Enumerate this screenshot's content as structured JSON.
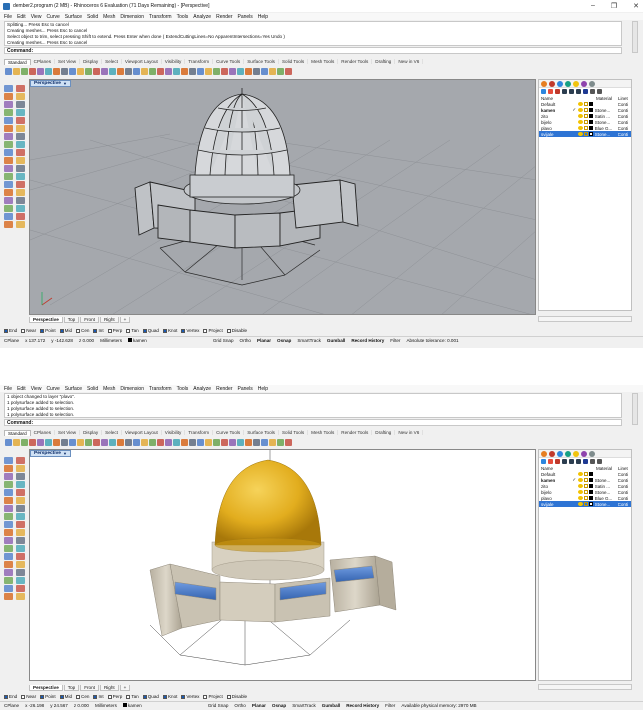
{
  "window": {
    "title": "dember2.program (2 MB) - Rhinoceros 6 Evaluation (71 Days Remaining) - [Perspective]",
    "min_glyph": "–",
    "max_glyph": "❐",
    "close_glyph": "✕"
  },
  "menu": [
    "File",
    "Edit",
    "View",
    "Curve",
    "Surface",
    "Solid",
    "Mesh",
    "Dimension",
    "Transform",
    "Tools",
    "Analyze",
    "Render",
    "Panels",
    "Help"
  ],
  "toolbar_tabs": [
    "Standard",
    "CPlanes",
    "Set View",
    "Display",
    "Select",
    "Viewport Layout",
    "Visibility",
    "Transform",
    "Curve Tools",
    "Surface Tools",
    "Solid Tools",
    "Mesh Tools",
    "Render Tools",
    "Drafting",
    "New in V6"
  ],
  "view_tabs": [
    "Perspective",
    "Top",
    "Front",
    "Right",
    "+"
  ],
  "viewport_label": "Perspective",
  "osnap": [
    {
      "label": "End",
      "on": true
    },
    {
      "label": "Near",
      "on": false
    },
    {
      "label": "Point",
      "on": true
    },
    {
      "label": "Mid",
      "on": true
    },
    {
      "label": "Cen",
      "on": false
    },
    {
      "label": "Int",
      "on": true
    },
    {
      "label": "Perp",
      "on": false
    },
    {
      "label": "Tan",
      "on": false
    },
    {
      "label": "Quad",
      "on": true
    },
    {
      "label": "Knot",
      "on": true
    },
    {
      "label": "Vertex",
      "on": true
    },
    {
      "label": "Project",
      "on": false
    },
    {
      "label": "Disable",
      "on": false
    }
  ],
  "layers": {
    "headers": {
      "name": "Name",
      "material": "Material",
      "linetype": "Linet"
    },
    "rows": [
      {
        "name": "Default",
        "check": "",
        "swatch": "#000000",
        "material": "",
        "linetype": "Conti",
        "bold": false,
        "selected": false
      },
      {
        "name": "kamen",
        "check": "✓",
        "swatch": "#000000",
        "material": "Stone...",
        "linetype": "Conti",
        "bold": true,
        "selected": false
      },
      {
        "name": "zito",
        "check": "",
        "swatch": "#000000",
        "material": "Satin ...",
        "linetype": "Conti",
        "bold": false,
        "selected": false
      },
      {
        "name": "bijelo",
        "check": "",
        "swatch": "#000000",
        "material": "Stone...",
        "linetype": "Conti",
        "bold": false,
        "selected": false
      },
      {
        "name": "plavo",
        "check": "",
        "swatch": "#000000",
        "material": "Blue G...",
        "linetype": "Conti",
        "bold": false,
        "selected": false
      },
      {
        "name": "svijale",
        "check": "",
        "swatch": "#ffffff",
        "material": "Stone...",
        "linetype": "Conti",
        "bold": false,
        "selected": true
      }
    ]
  },
  "shot1": {
    "history": [
      "Splitting... Press Esc to cancel",
      "Creating meshes... Press Esc to cancel",
      "Select object to trim, select pressing Shift to extend. Press Enter when done ( ExtendCuttingLines=No ApparentIntersections=Yes Undo )",
      "Creating meshes... Press Esc to cancel"
    ],
    "command_label": "Command:",
    "status": {
      "cplane": "CPlane",
      "x": "x 137.172",
      "y": "y -142.628",
      "z": "z 0.000",
      "units": "Millimeters",
      "layer": "kamen",
      "grid_snap": "Grid Snap",
      "ortho": "Ortho",
      "planar": "Planar",
      "osnap": "Osnap",
      "smarttrack": "SmartTrack",
      "gumball": "Gumball",
      "record": "Record History",
      "filter": "Filter",
      "message": "Absolute tolerance: 0.001"
    }
  },
  "shot2": {
    "history": [
      "1 object changed to layer \"plavo\".",
      "1 polysurface added to selection.",
      "1 polysurface added to selection.",
      "1 polysurface added to selection."
    ],
    "command_label": "Command:",
    "status": {
      "cplane": "CPlane",
      "x": "x -26.198",
      "y": "y 24.567",
      "z": "z 0.000",
      "units": "Millimeters",
      "layer": "kamen",
      "grid_snap": "Grid Snap",
      "ortho": "Ortho",
      "planar": "Planar",
      "osnap": "Osnap",
      "smarttrack": "SmartTrack",
      "gumball": "Gumball",
      "record": "Record History",
      "filter": "Filter",
      "message": "Available physical memory: 2970 MB"
    }
  },
  "colors": {
    "dome_gold": "#e2ad1e",
    "wall_stone": "#c9c2b2",
    "bench_blue": "#4a7cc9",
    "viewport_grey": "#a5a8ad",
    "selection_blue": "#2e74d4"
  }
}
